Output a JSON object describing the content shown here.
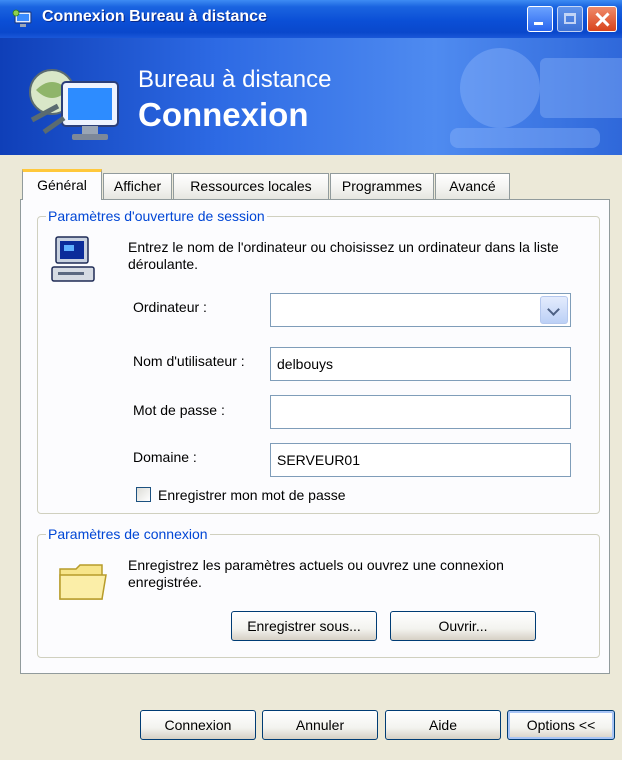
{
  "window": {
    "title": "Connexion Bureau à distance",
    "icons": {
      "app": "remote-desktop-icon",
      "minimize": "minimize-icon",
      "maximize": "maximize-icon",
      "close": "close-icon"
    }
  },
  "banner": {
    "line1": "Bureau à distance",
    "line2": "Connexion",
    "logo": "remote-desktop-logo"
  },
  "tabs": [
    {
      "label": "Général",
      "active": true
    },
    {
      "label": "Afficher"
    },
    {
      "label": "Ressources locales"
    },
    {
      "label": "Programmes"
    },
    {
      "label": "Avancé"
    }
  ],
  "logon": {
    "group_title": "Paramètres d'ouverture de session",
    "description": "Entrez le nom de l'ordinateur ou choisissez un ordinateur dans la liste déroulante.",
    "computer_label": "Ordinateur :",
    "computer_value": "",
    "username_label": "Nom d'utilisateur :",
    "username_value": "delbouys",
    "password_label": "Mot de passe :",
    "password_value": "",
    "domain_label": "Domaine :",
    "domain_value": "SERVEUR01",
    "save_password_label": "Enregistrer mon mot de passe",
    "save_password_checked": false
  },
  "connection": {
    "group_title": "Paramètres de connexion",
    "description": "Enregistrez les paramètres actuels ou ouvrez une connexion enregistrée.",
    "save_as_label": "Enregistrer sous...",
    "open_label": "Ouvrir..."
  },
  "footer": {
    "connect_label": "Connexion",
    "cancel_label": "Annuler",
    "help_label": "Aide",
    "options_label": "Options <<"
  },
  "colors": {
    "titlebar": "#0b4fd6",
    "banner": "#2d6ae4",
    "dialog_bg": "#ece9d8",
    "group_title": "#0046d5",
    "active_tab_accent": "#ffc83c"
  }
}
